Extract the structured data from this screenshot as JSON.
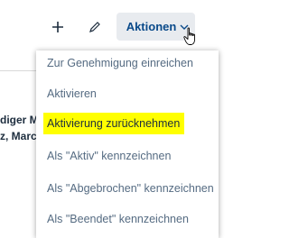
{
  "toolbar": {
    "add_icon": "plus-icon",
    "edit_icon": "pencil-icon",
    "actions_label": "Aktionen",
    "actions_chevron": "chevron-down-icon"
  },
  "background": {
    "line1": "diger Mi",
    "line2": "z, Marc"
  },
  "menu": {
    "items": [
      {
        "label": "Zur Genehmigung einreichen"
      },
      {
        "label": "Aktivieren"
      },
      {
        "label": "Aktivierung zurücknehmen",
        "highlighted": true
      },
      {
        "label": "Als \"Aktiv\" kennzeichnen"
      },
      {
        "label": "Als \"Abgebrochen\" kennzeichnen"
      },
      {
        "label": "Als \"Beendet\" kennzeichnen"
      }
    ]
  },
  "colors": {
    "accent_text": "#0a4a8a",
    "highlight": "#ffff00",
    "menu_text": "#556b82"
  }
}
